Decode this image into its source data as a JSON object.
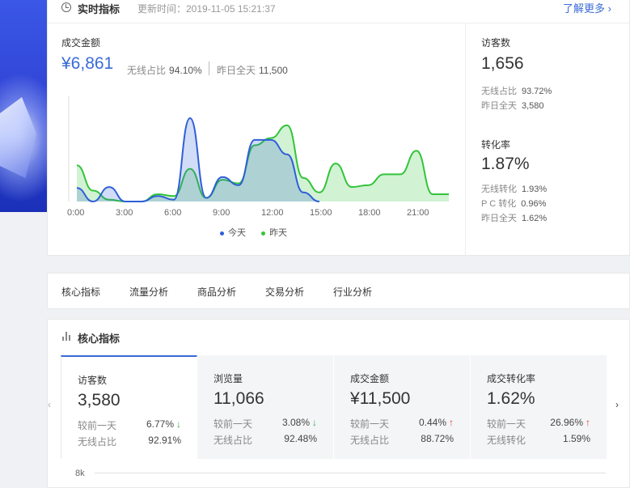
{
  "realtime": {
    "title": "实时指标",
    "update_time": "更新时间：2019-11-05 15:21:37",
    "more_link": "了解更多 ›",
    "gmv_label": "成交金额",
    "gmv_value": "¥6,861",
    "wireless_ratio_label": "无线占比",
    "wireless_ratio_value": "94.10%",
    "yesterday_label": "昨日全天",
    "yesterday_value": "11,500",
    "visitors_label": "访客数",
    "visitors_value": "1,656",
    "visitors_wireless_label": "无线占比",
    "visitors_wireless_value": "93.72%",
    "visitors_yesterday_label": "昨日全天",
    "visitors_yesterday_value": "3,580",
    "conv_label": "转化率",
    "conv_value": "1.87%",
    "conv_wireless_label": "无线转化",
    "conv_wireless_value": "1.93%",
    "conv_pc_label": "P C 转化",
    "conv_pc_value": "0.96%",
    "conv_yesterday_label": "昨日全天",
    "conv_yesterday_value": "1.62%"
  },
  "chart_data": {
    "type": "area",
    "x": [
      "0:00",
      "1:00",
      "2:00",
      "3:00",
      "4:00",
      "5:00",
      "6:00",
      "7:00",
      "8:00",
      "9:00",
      "10:00",
      "11:00",
      "12:00",
      "13:00",
      "14:00",
      "15:00",
      "16:00",
      "17:00",
      "18:00",
      "19:00",
      "20:00",
      "21:00",
      "22:00",
      "23:00"
    ],
    "tick_labels": [
      "0:00",
      "3:00",
      "6:00",
      "9:00",
      "12:00",
      "15:00",
      "18:00",
      "21:00"
    ],
    "series": [
      {
        "name": "今天",
        "color": "#2f5fd8",
        "values": [
          15,
          0,
          16,
          0,
          0,
          6,
          2,
          92,
          4,
          27,
          18,
          68,
          68,
          52,
          10,
          0,
          null,
          null,
          null,
          null,
          null,
          null,
          null,
          null
        ]
      },
      {
        "name": "昨天",
        "color": "#33c43a",
        "values": [
          40,
          12,
          2,
          0,
          0,
          8,
          6,
          36,
          4,
          24,
          20,
          62,
          70,
          84,
          26,
          10,
          42,
          16,
          18,
          30,
          30,
          56,
          8,
          8
        ]
      }
    ],
    "legend": [
      "今天",
      "昨天"
    ],
    "legend_position": "bottom",
    "grid": false
  },
  "tabs": [
    "核心指标",
    "流量分析",
    "商品分析",
    "交易分析",
    "行业分析"
  ],
  "core": {
    "title": "核心指标",
    "nav_left": "‹",
    "nav_right": "›",
    "y_tick": "8k",
    "metrics": [
      {
        "name": "访客数",
        "value": "3,580",
        "r1_label": "较前一天",
        "r1_value": "6.77%",
        "r1_arrow": "↓",
        "r2_label": "无线占比",
        "r2_value": "92.91%"
      },
      {
        "name": "浏览量",
        "value": "11,066",
        "r1_label": "较前一天",
        "r1_value": "3.08%",
        "r1_arrow": "↓",
        "r2_label": "无线占比",
        "r2_value": "92.48%"
      },
      {
        "name": "成交金额",
        "value": "¥11,500",
        "r1_label": "较前一天",
        "r1_value": "0.44%",
        "r1_arrow": "↑",
        "r2_label": "无线占比",
        "r2_value": "88.72%"
      },
      {
        "name": "成交转化率",
        "value": "1.62%",
        "r1_label": "较前一天",
        "r1_value": "26.96%",
        "r1_arrow": "↑",
        "r2_label": "无线转化",
        "r2_value": "1.59%"
      }
    ]
  }
}
